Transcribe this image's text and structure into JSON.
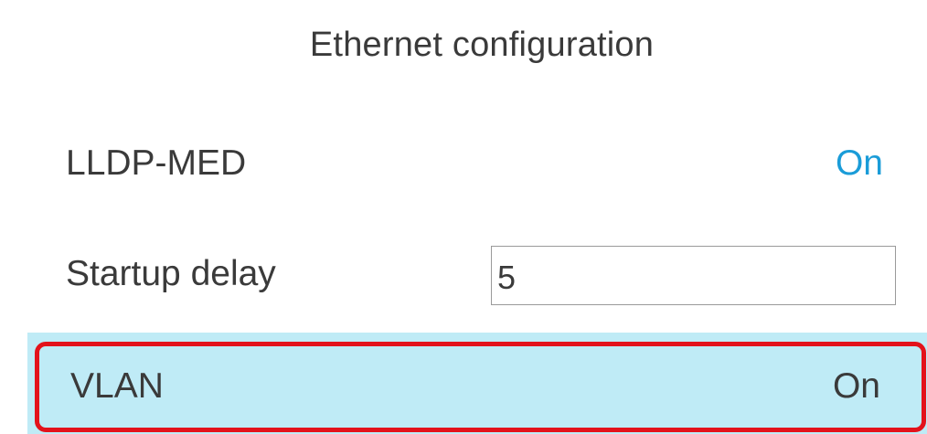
{
  "header": {
    "title": "Ethernet configuration"
  },
  "settings": {
    "lldp_med": {
      "label": "LLDP-MED",
      "value": "On"
    },
    "startup_delay": {
      "label": "Startup delay",
      "value": "5"
    },
    "vlan": {
      "label": "VLAN",
      "value": "On"
    }
  },
  "colors": {
    "accent_value": "#1a9cd8",
    "selected_row": "#bfebf6",
    "highlight_border": "#e3121b",
    "text": "#3a3a3a"
  }
}
